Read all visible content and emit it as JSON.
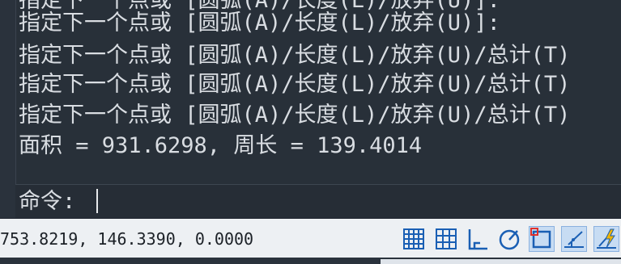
{
  "history": {
    "lines": [
      "指定下一个点或 [圆弧(A)/长度(L)/放弃(U)]:",
      "指定下一个点或 [圆弧(A)/长度(L)/放弃(U)]:",
      "指定下一个点或 [圆弧(A)/长度(L)/放弃(U)/总计(T)",
      "指定下一个点或 [圆弧(A)/长度(L)/放弃(U)/总计(T)",
      "指定下一个点或 [圆弧(A)/长度(L)/放弃(U)/总计(T)",
      "面积 = 931.6298, 周长 = 139.4014"
    ]
  },
  "command": {
    "prompt": "命令:",
    "value": ""
  },
  "status": {
    "coordinates": "753.8219, 146.3390, 0.0000",
    "buttons": [
      {
        "name": "grid-display",
        "icon": "grid-icon",
        "active": false
      },
      {
        "name": "snap-mode",
        "icon": "snap-grid-icon",
        "active": false
      },
      {
        "name": "ortho-mode",
        "icon": "ortho-icon",
        "active": false
      },
      {
        "name": "polar-tracking",
        "icon": "polar-icon",
        "active": false
      },
      {
        "name": "object-snap",
        "icon": "osnap-icon",
        "active": true
      },
      {
        "name": "snap-tracking",
        "icon": "tracking-icon",
        "active": true
      },
      {
        "name": "dynamic-input",
        "icon": "lightning-icon",
        "active": true
      }
    ]
  },
  "colors": {
    "history_bg": "#283039",
    "command_bg": "#262d36",
    "text": "#d9dde2",
    "status_bg": "#edf0f3",
    "icon_blue": "#1a5fb4",
    "active_bg": "#c7dcf3",
    "snap_marker": "#e0302a"
  }
}
